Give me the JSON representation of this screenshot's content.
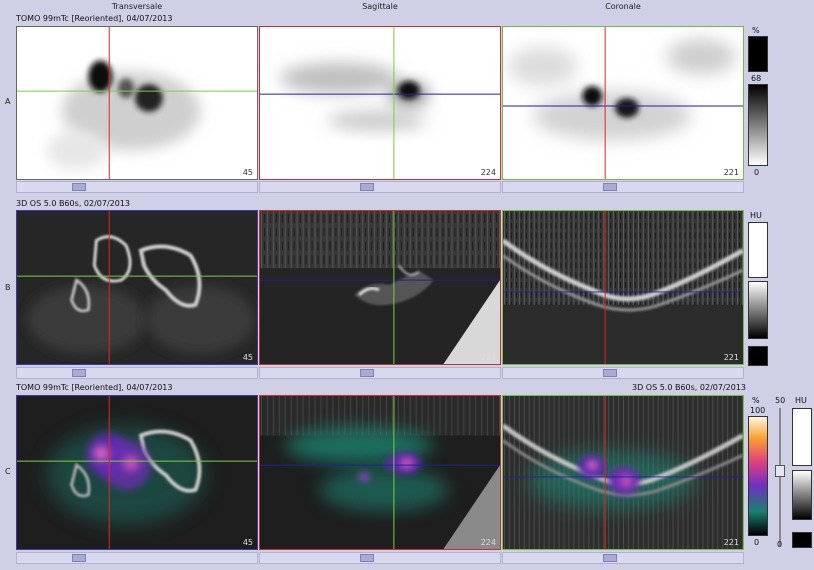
{
  "columns": [
    "Transversale",
    "Sagittale",
    "Coronale"
  ],
  "rows": [
    {
      "label": "A",
      "caption": "TOMO 99mTc [Reoriented], 04/07/2013",
      "slices": [
        "45",
        "224",
        "221"
      ]
    },
    {
      "label": "B",
      "caption": "3D  OS  5.0  B60s, 02/07/2013",
      "slices": [
        "45",
        "224",
        "221"
      ]
    },
    {
      "label": "C",
      "caption": "TOMO 99mTc [Reoriented], 04/07/2013",
      "caption_right": "3D  OS  5.0  B60s, 02/07/2013",
      "slices": [
        "45",
        "224",
        "221"
      ]
    }
  ],
  "scales": {
    "a": {
      "unit": "%",
      "max": "68",
      "min": "0"
    },
    "b": {
      "unit": "HU"
    },
    "c": {
      "unit": "%",
      "max": "100",
      "min": "0",
      "slider_value": "50",
      "unit2": "HU"
    }
  },
  "colors": {
    "background": "#cfd0e6",
    "cross_red": "#e0281f",
    "cross_green": "#78d23c",
    "cross_blue": "#2020a0",
    "frame_transversal": "#3a3aa8",
    "frame_sagittal": "#c83030",
    "frame_coronal": "#70c040"
  }
}
